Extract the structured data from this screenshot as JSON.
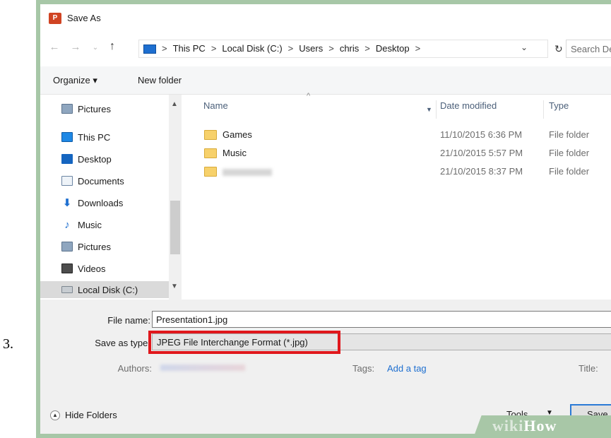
{
  "step_number": "3.",
  "window": {
    "title": "Save As",
    "app_icon_text": "P"
  },
  "address_bar": {
    "crumbs": [
      "This PC",
      "Local Disk (C:)",
      "Users",
      "chris",
      "Desktop"
    ],
    "separator": ">",
    "search_placeholder": "Search De"
  },
  "toolbar": {
    "organize_label": "Organize ▾",
    "new_folder_label": "New folder"
  },
  "nav_pane": {
    "items": [
      {
        "label": "Pictures",
        "icon": "pictures-icon"
      },
      {
        "label": "This PC",
        "icon": "this-pc-icon"
      },
      {
        "label": "Desktop",
        "icon": "desktop-icon"
      },
      {
        "label": "Documents",
        "icon": "documents-icon"
      },
      {
        "label": "Downloads",
        "icon": "downloads-icon"
      },
      {
        "label": "Music",
        "icon": "music-icon"
      },
      {
        "label": "Pictures",
        "icon": "pictures-icon"
      },
      {
        "label": "Videos",
        "icon": "videos-icon"
      },
      {
        "label": "Local Disk (C:)",
        "icon": "local-disk-icon",
        "selected": true
      }
    ]
  },
  "file_list": {
    "columns": {
      "name": "Name",
      "date": "Date modified",
      "type": "Type"
    },
    "rows": [
      {
        "name": "Games",
        "date": "11/10/2015 6:36 PM",
        "type": "File folder"
      },
      {
        "name": "Music",
        "date": "21/10/2015 5:57 PM",
        "type": "File folder"
      },
      {
        "name": "",
        "date": "21/10/2015 8:37 PM",
        "type": "File folder",
        "name_obscured": true
      }
    ]
  },
  "form": {
    "file_name_label": "File name:",
    "file_name_value": "Presentation1.jpg",
    "save_type_label": "Save as type:",
    "save_type_value": "JPEG File Interchange Format (*.jpg)",
    "authors_label": "Authors:",
    "tags_label": "Tags:",
    "tags_link": "Add a tag",
    "title_label": "Title:"
  },
  "footer": {
    "hide_folders_label": "Hide Folders",
    "tools_label": "Tools",
    "save_label": "Save"
  },
  "watermark": {
    "prefix": "wiki",
    "suffix": "How"
  },
  "colors": {
    "highlight": "#e0171c",
    "folder": "#f7d16b",
    "link": "#1e6fd0",
    "frame": "#a7c7a7"
  }
}
